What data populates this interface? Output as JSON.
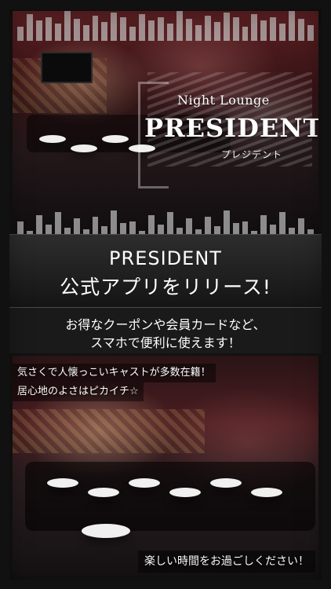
{
  "hero": {
    "logo_line1": "Night Lounge",
    "logo_line2": "PRESIDENT",
    "logo_kana": "プレジデント"
  },
  "announcement": {
    "title_line1": "PRESIDENT",
    "title_line2": "公式アプリをリリース!",
    "subtitle_line1": "お得なクーポンや会員カードなど、",
    "subtitle_line2": "スマホで便利に使えます！"
  },
  "gallery": {
    "caption_line1": "気さくで人懐っこいキャストが多数在籍！",
    "caption_line2": "居心地のよさはピカイチ☆",
    "caption_bottom": "楽しい時間をお過ごしください！"
  },
  "colors": {
    "background": "#141414",
    "band_dark": "#151515",
    "text": "#ffffff",
    "accent_red": "#5a1f22"
  }
}
